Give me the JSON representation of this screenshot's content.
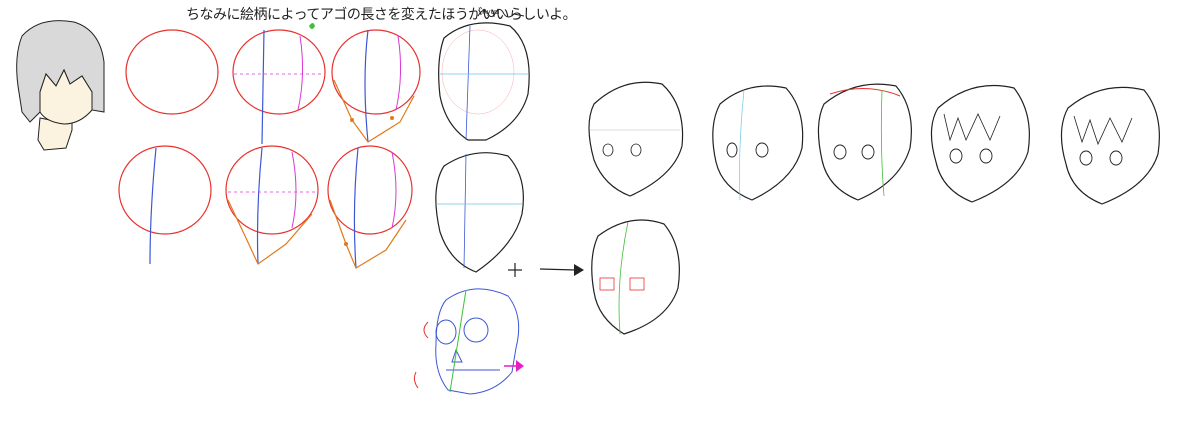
{
  "annotation": {
    "note_text": "ちなみに絵柄によってアゴの長さを変えたほうがいいらしいよ。"
  },
  "signature": {
    "text": "Ryuu"
  },
  "colors": {
    "circle": "#e8322e",
    "center_line": "#3d57d6",
    "jaw": "#e07a1e",
    "guide_pink": "#d83ad6",
    "guide_green": "#3fbf3a",
    "guide_cyan": "#6ec9e6",
    "line": "#222222",
    "hair_fill": "#d9d9d9",
    "skin_fill": "#fbf3df",
    "arrow_pink": "#e61ec8"
  },
  "icons": [
    "plus-sign",
    "arrow-right-icon",
    "signature-doodle",
    "leaf-doodle"
  ]
}
